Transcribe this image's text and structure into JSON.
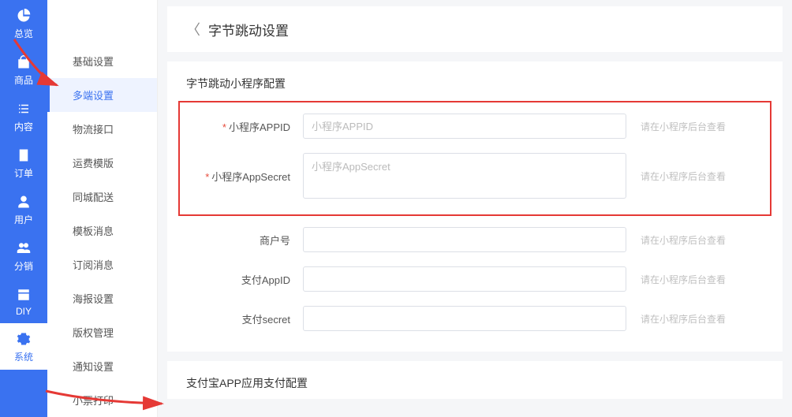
{
  "rail": {
    "items": [
      {
        "label": "总览",
        "icon": "pie"
      },
      {
        "label": "商品",
        "icon": "bag"
      },
      {
        "label": "内容",
        "icon": "list"
      },
      {
        "label": "订单",
        "icon": "doc"
      },
      {
        "label": "用户",
        "icon": "user"
      },
      {
        "label": "分销",
        "icon": "users"
      },
      {
        "label": "DIY",
        "icon": "box"
      },
      {
        "label": "系统",
        "icon": "gear"
      }
    ]
  },
  "submenu": {
    "items": [
      "基础设置",
      "多端设置",
      "物流接口",
      "运费模版",
      "同城配送",
      "模板消息",
      "订阅消息",
      "海报设置",
      "版权管理",
      "通知设置",
      "小票打印"
    ],
    "active_index": 1
  },
  "page": {
    "title": "字节跳动设置"
  },
  "section_byte": {
    "title": "字节跳动小程序配置",
    "rows": [
      {
        "label": "小程序APPID",
        "placeholder": "小程序APPID",
        "required": true,
        "type": "input",
        "hint": "请在小程序后台查看"
      },
      {
        "label": "小程序AppSecret",
        "placeholder": "小程序AppSecret",
        "required": true,
        "type": "textarea",
        "hint": "请在小程序后台查看"
      },
      {
        "label": "商户号",
        "placeholder": "",
        "required": false,
        "type": "input",
        "hint": "请在小程序后台查看"
      },
      {
        "label": "支付AppID",
        "placeholder": "",
        "required": false,
        "type": "input",
        "hint": "请在小程序后台查看"
      },
      {
        "label": "支付secret",
        "placeholder": "",
        "required": false,
        "type": "input",
        "hint": "请在小程序后台查看"
      }
    ]
  },
  "section_alipay": {
    "title": "支付宝APP应用支付配置"
  },
  "req_marker": "*"
}
